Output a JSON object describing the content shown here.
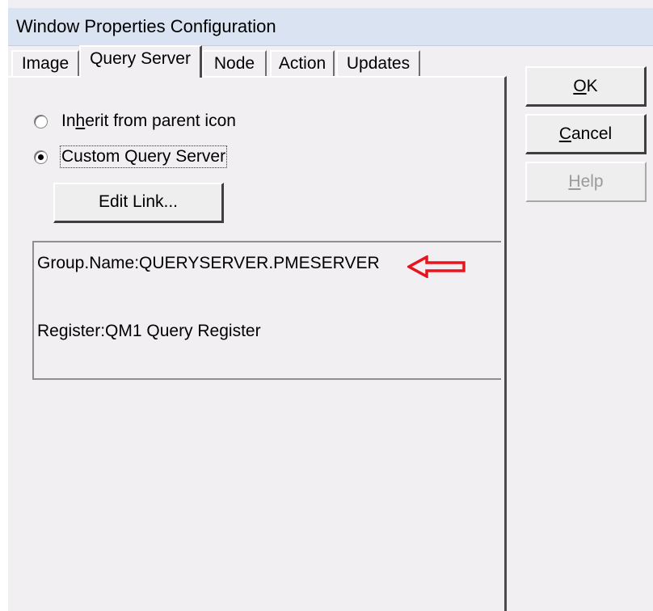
{
  "window": {
    "title": "Window Properties Configuration"
  },
  "tabs": [
    {
      "label": "Image",
      "active": false
    },
    {
      "label": "Query Server",
      "active": true
    },
    {
      "label": "Node",
      "active": false
    },
    {
      "label": "Action",
      "active": false
    },
    {
      "label": "Updates",
      "active": false
    }
  ],
  "query_server": {
    "options": [
      {
        "label_mnemonic_before": "In",
        "label_mnemonic": "h",
        "label_after": "erit from parent icon",
        "selected": false
      },
      {
        "label": "Custom Query Server",
        "selected": true
      }
    ],
    "edit_link_label": "Edit Link...",
    "link_info": {
      "group_name": "Group.Name:QUERYSERVER.PMESERVER",
      "register": "Register:QM1 Query Register"
    },
    "annotation_arrow": {
      "color": "#e8141c",
      "points_to": "group_name"
    }
  },
  "buttons": {
    "ok": {
      "mnemonic": "O",
      "rest": "K",
      "enabled": true
    },
    "cancel": {
      "mnemonic": "C",
      "rest": "ancel",
      "enabled": true
    },
    "help": {
      "mnemonic": "H",
      "rest": "elp",
      "enabled": false
    }
  },
  "colors": {
    "title_bar": "#d9e3f1",
    "dialog_background": "#f2eff2",
    "annotation_red": "#e8141c"
  }
}
